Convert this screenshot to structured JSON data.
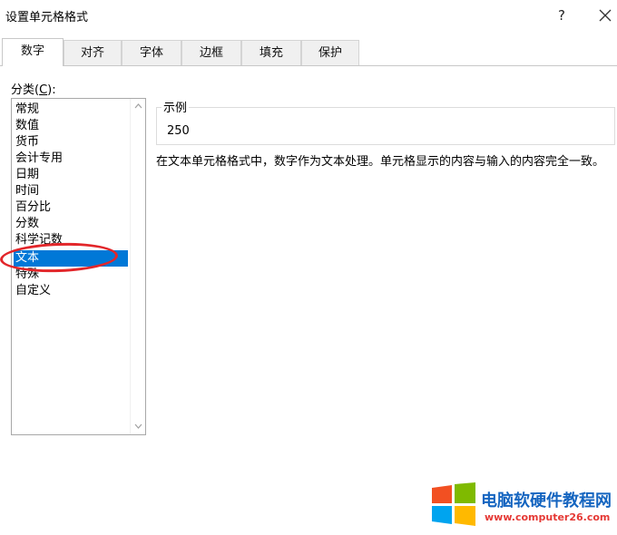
{
  "dialog": {
    "title": "设置单元格格式",
    "help_label": "?"
  },
  "tabs": [
    {
      "label": "数字",
      "active": true
    },
    {
      "label": "对齐",
      "active": false
    },
    {
      "label": "字体",
      "active": false
    },
    {
      "label": "边框",
      "active": false
    },
    {
      "label": "填充",
      "active": false
    },
    {
      "label": "保护",
      "active": false
    }
  ],
  "category": {
    "label_prefix": "分类(",
    "label_key": "C",
    "label_suffix": "):",
    "items": [
      "常规",
      "数值",
      "货币",
      "会计专用",
      "日期",
      "时间",
      "百分比",
      "分数",
      "科学记数",
      "文本",
      "特殊",
      "自定义"
    ],
    "selected": "文本"
  },
  "sample": {
    "legend": "示例",
    "value": "250"
  },
  "description": "在文本单元格格式中，数字作为文本处理。单元格显示的内容与输入的内容完全一致。",
  "watermark": {
    "title": "电脑软硬件教程网",
    "url": "www.computer26.com"
  },
  "colors": {
    "selection": "#0078d7",
    "annotation_ring": "#e2262a",
    "watermark_title": "#1565c0",
    "watermark_url": "#e53935"
  }
}
